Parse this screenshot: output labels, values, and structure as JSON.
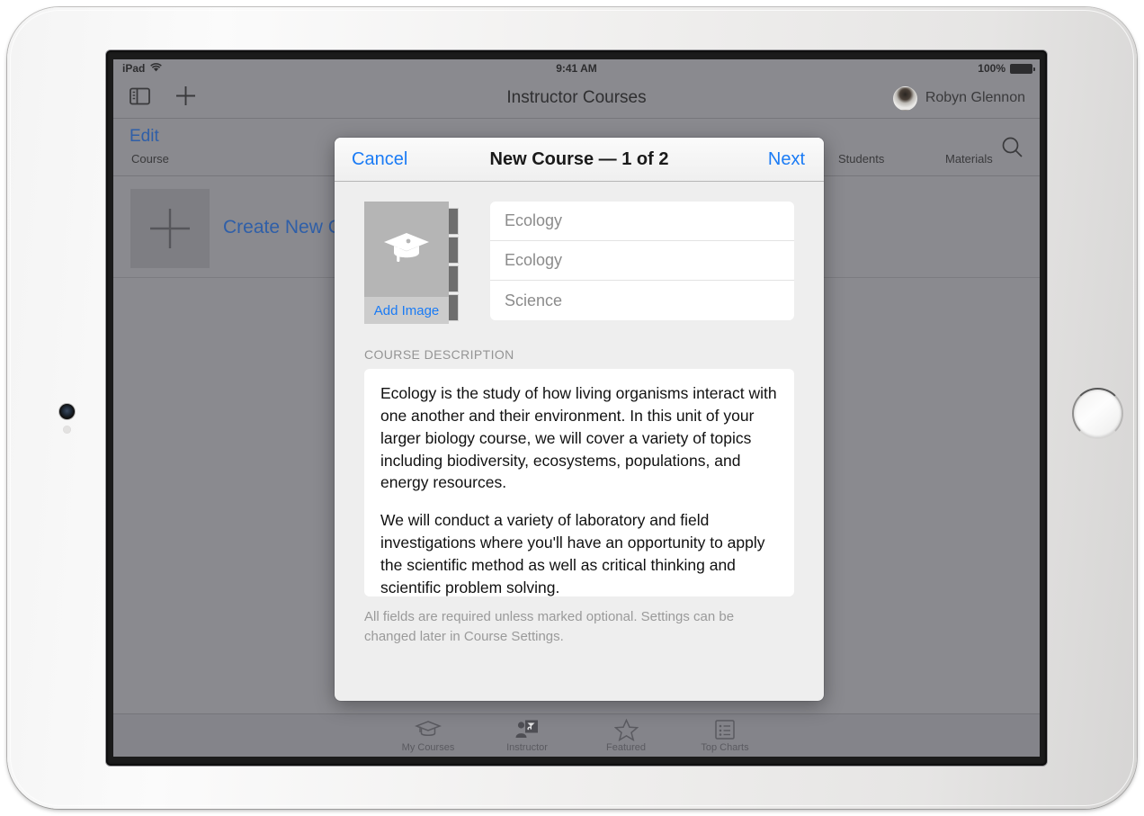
{
  "device": {
    "name": "ipad-landscape"
  },
  "statusbar": {
    "carrier": "iPad",
    "wifi_icon": "wifi-icon",
    "time": "9:41 AM",
    "battery_percent": "100%",
    "battery_icon": "battery-full-icon"
  },
  "navbar": {
    "sidebar_icon": "sidebar-toggle-icon",
    "add_icon": "plus-icon",
    "title": "Instructor Courses",
    "user_name": "Robyn Glennon",
    "avatar_icon": "avatar"
  },
  "subbar": {
    "edit_label": "Edit",
    "search_icon": "search-icon",
    "columns": [
      "Course",
      "Students",
      "Materials"
    ]
  },
  "course_list": {
    "create_row": {
      "plus_icon": "plus-icon",
      "label": "Create New Course"
    }
  },
  "tabbar": {
    "tabs": [
      {
        "label": "My Courses",
        "icon": "graduation-cap-icon",
        "selected": false
      },
      {
        "label": "Instructor",
        "icon": "instructor-whiteboard-icon",
        "selected": true
      },
      {
        "label": "Featured",
        "icon": "star-icon",
        "selected": false
      },
      {
        "label": "Top Charts",
        "icon": "list-icon",
        "selected": false
      }
    ]
  },
  "modal": {
    "cancel_label": "Cancel",
    "title": "New Course — 1 of 2",
    "next_label": "Next",
    "image_picker": {
      "placeholder_icon": "graduation-cap-icon",
      "add_image_label": "Add Image"
    },
    "fields": [
      {
        "name": "course-title",
        "placeholder": "Ecology",
        "value": ""
      },
      {
        "name": "course-short-name",
        "placeholder": "Ecology",
        "value": ""
      },
      {
        "name": "course-subject",
        "placeholder": "Science",
        "value": ""
      }
    ],
    "description": {
      "section_label": "COURSE DESCRIPTION",
      "paragraphs": [
        "Ecology is the study of how living organisms interact with one another and their environment. In this unit of your larger biology course, we will cover a variety of topics including biodiversity, ecosystems, populations, and energy resources.",
        "We will conduct a variety of laboratory and field investigations where you'll have an opportunity to apply the scientific method as well as critical thinking and scientific problem solving."
      ]
    },
    "footnote": "All fields are required unless marked optional. Settings can be changed later in Course Settings."
  },
  "colors": {
    "accent_blue": "#1a7bf5",
    "dim_overlay": "#8a8a8f",
    "modal_bg": "#eeeeee",
    "card_white": "#ffffff"
  }
}
